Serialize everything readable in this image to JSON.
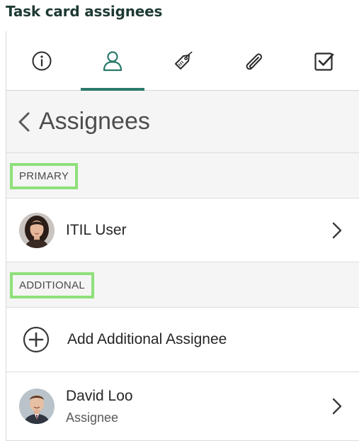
{
  "caption": "Task card assignees",
  "tabs": [
    {
      "icon": "info-icon"
    },
    {
      "icon": "person-icon",
      "active": true
    },
    {
      "icon": "tag-icon"
    },
    {
      "icon": "paperclip-icon"
    },
    {
      "icon": "checkbox-icon"
    }
  ],
  "header": {
    "title": "Assignees"
  },
  "sections": {
    "primary": "PRIMARY",
    "additional": "ADDITIONAL"
  },
  "primary_assignee": {
    "name": "ITIL User"
  },
  "add_assignee": {
    "label": "Add Additional Assignee"
  },
  "additional_assignees": [
    {
      "name": "David Loo",
      "role": "Assignee"
    }
  ],
  "colors": {
    "accent": "#2b7a6a",
    "highlight": "#8ee07a"
  }
}
